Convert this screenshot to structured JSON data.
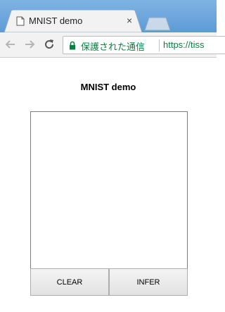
{
  "browser": {
    "tab_title": "MNIST demo",
    "tab_close": "×",
    "security_text": "保護された通信",
    "url": "https://tiss"
  },
  "page": {
    "title": "MNIST demo",
    "buttons": {
      "clear": "CLEAR",
      "infer": "INFER"
    }
  },
  "colors": {
    "tabstrip": "#6aa6dd",
    "secure_green": "#0b8043",
    "toolbar": "#f2f2f2"
  },
  "icons": {
    "favicon": "page-icon",
    "back": "back-arrow-icon",
    "forward": "forward-arrow-icon",
    "reload": "reload-icon",
    "lock": "lock-icon"
  }
}
